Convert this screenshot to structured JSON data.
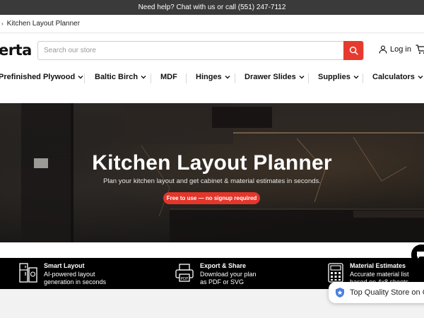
{
  "topbar": {
    "text": "Need help? Chat with us or call (551) 247-7112"
  },
  "breadcrumb": {
    "current": "Kitchen Layout Planner"
  },
  "header": {
    "logo": "erta",
    "search_placeholder": "Search our store",
    "login_label": "Log in"
  },
  "nav": {
    "items": [
      {
        "label": "Prefinished Plywood",
        "has_menu": true
      },
      {
        "label": "Baltic Birch",
        "has_menu": true
      },
      {
        "label": "MDF",
        "has_menu": false
      },
      {
        "label": "Hinges",
        "has_menu": true
      },
      {
        "label": "Drawer Slides",
        "has_menu": true
      },
      {
        "label": "Supplies",
        "has_menu": true
      },
      {
        "label": "Calculators",
        "has_menu": true
      }
    ]
  },
  "hero": {
    "title": "Kitchen Layout Planner",
    "subtitle": "Plan your kitchen layout and get cabinet & material estimates in seconds.",
    "badge": "Free to use — no signup required"
  },
  "features": [
    {
      "title": "Smart Layout",
      "line1": "AI-powered layout",
      "line2": "generation in seconds",
      "icon": "fridge-layout-icon"
    },
    {
      "title": "Export & Share",
      "line1": "Download your plan",
      "line2": "as PDF or SVG",
      "icon": "printer-icon"
    },
    {
      "title": "Material Estimates",
      "line1": "Accurate material list",
      "line2": "based on 4x8 sheets",
      "icon": "calculator-icon"
    }
  ],
  "trust_badge": {
    "text": "Top Quality Store on G"
  },
  "colors": {
    "accent": "#e63a2e",
    "topbar": "#3a3a3a",
    "feature_bar": "#000000"
  }
}
